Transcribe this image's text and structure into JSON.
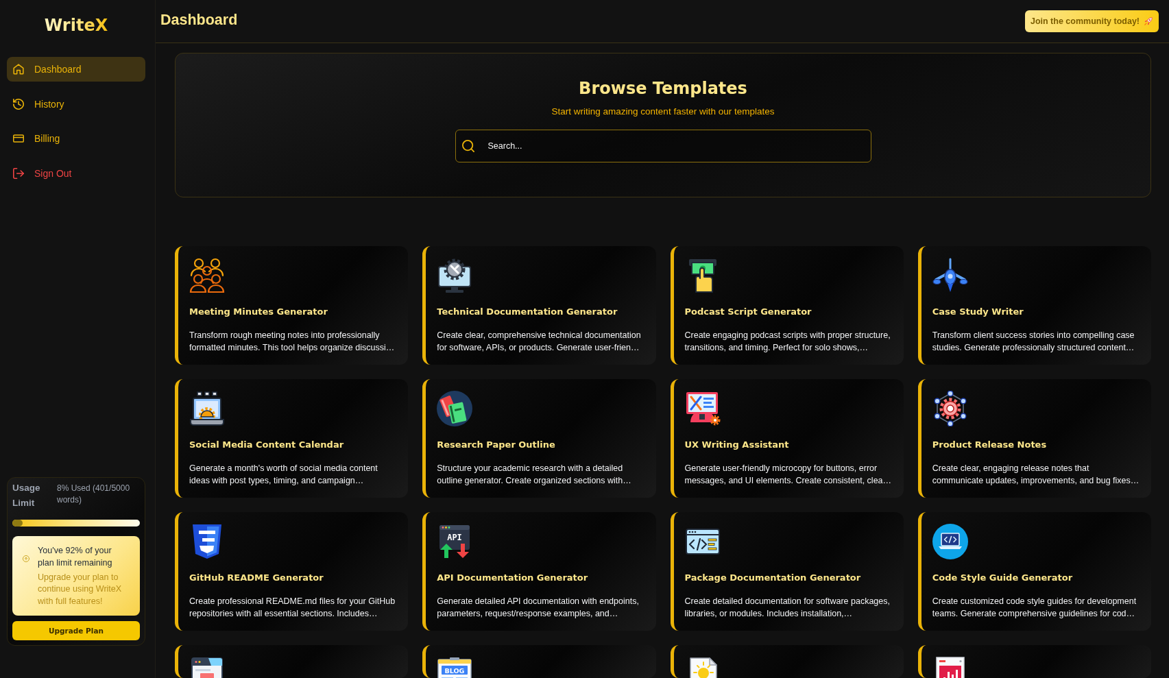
{
  "sidebar": {
    "logo": "WriteX",
    "items": [
      {
        "label": "Dashboard",
        "kind": "page",
        "selected": true
      },
      {
        "label": "History",
        "kind": "page",
        "selected": false
      },
      {
        "label": "Billing",
        "kind": "page",
        "selected": false
      },
      {
        "label": "Sign Out",
        "kind": "logout",
        "selected": false
      }
    ],
    "usage": {
      "title": "Usage Limit",
      "reading": "8% Used (401/5000 words)",
      "level": 0.08,
      "notice": {
        "heading": "You've 92% of your plan limit remaining",
        "text": "Upgrade your plan to continue using WriteX with full features!"
      },
      "button": "Upgrade Plan"
    }
  },
  "header": {
    "title": "Dashboard",
    "button": "Join the community today!"
  },
  "hero": {
    "title": "Browse Templates",
    "subtitle": "Start writing amazing content faster with our templates",
    "search": {
      "placeholder": "Search..."
    }
  },
  "templates": [
    {
      "title": "Meeting Minutes Generator",
      "description": "Transform rough meeting notes into professionally formatted minutes. This tool helps organize discussi…",
      "cut": false
    },
    {
      "title": "Technical Documentation Generator",
      "description": "Create clear, comprehensive technical documentation for software, APIs, or products. Generate user-frien…",
      "cut": false
    },
    {
      "title": "Podcast Script Generator",
      "description": "Create engaging podcast scripts with proper structure, transitions, and timing. Perfect for solo shows,…",
      "cut": false
    },
    {
      "title": "Case Study Writer",
      "description": "Transform client success stories into compelling case studies. Generate professionally structured content…",
      "cut": false
    },
    {
      "title": "Social Media Content Calendar",
      "description": "Generate a month's worth of social media content ideas with post types, timing, and campaign…",
      "cut": false
    },
    {
      "title": "Research Paper Outline",
      "description": "Structure your academic research with a detailed outline generator. Create organized sections with…",
      "cut": false
    },
    {
      "title": "UX Writing Assistant",
      "description": "Generate user-friendly microcopy for buttons, error messages, and UI elements. Create consistent, clea…",
      "cut": false
    },
    {
      "title": "Product Release Notes",
      "description": "Create clear, engaging release notes that communicate updates, improvements, and bug fixes…",
      "cut": false
    },
    {
      "title": "GitHub README Generator",
      "description": "Create professional README.md files for your GitHub repositories with all essential sections. Includes…",
      "cut": false
    },
    {
      "title": "API Documentation Generator",
      "description": "Generate detailed API documentation with endpoints, parameters, request/response examples, and…",
      "icon_text": "API",
      "cut": false
    },
    {
      "title": "Package Documentation Generator",
      "description": "Create detailed documentation for software packages, libraries, or modules. Includes installation,…",
      "cut": false
    },
    {
      "title": "Code Style Guide Generator",
      "description": "Create customized code style guides for development teams. Generate comprehensive guidelines for cod…",
      "cut": false
    },
    {
      "cut": true
    },
    {
      "icon_text": "BLOG",
      "cut": true
    },
    {
      "cut": true
    },
    {
      "cut": true
    }
  ]
}
